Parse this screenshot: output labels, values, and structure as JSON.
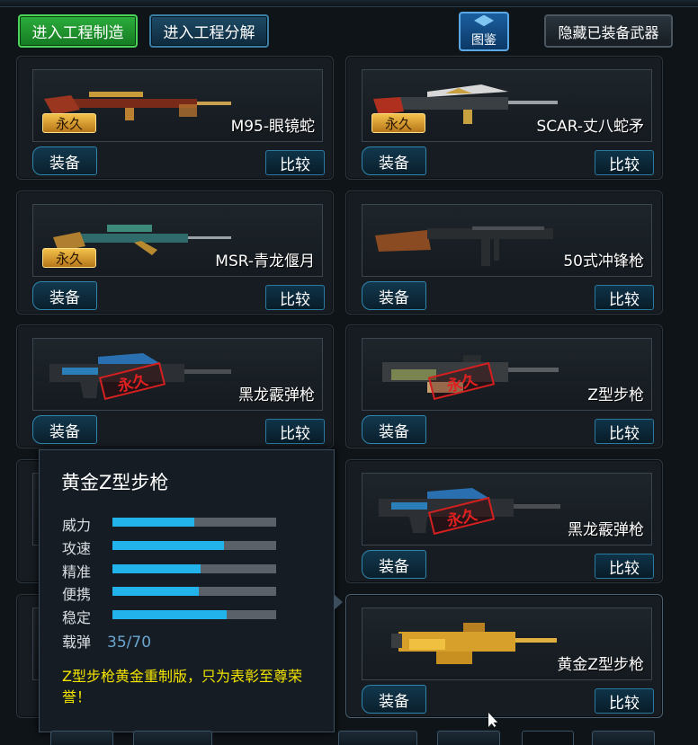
{
  "toolbar": {
    "enter_craft": "进入工程制造",
    "enter_disassemble": "进入工程分解",
    "gallery": "图鉴",
    "hide_equipped": "隐藏已装备武器"
  },
  "actions": {
    "equip": "装备",
    "compare": "比较"
  },
  "weapons": [
    {
      "name": "M95-眼镜蛇",
      "badge": "永久",
      "stamp": ""
    },
    {
      "name": "SCAR-丈八蛇矛",
      "badge": "永久",
      "stamp": ""
    },
    {
      "name": "MSR-青龙偃月",
      "badge": "永久",
      "stamp": ""
    },
    {
      "name": "50式冲锋枪",
      "badge": "",
      "stamp": ""
    },
    {
      "name": "黑龙霰弹枪",
      "badge": "",
      "stamp": "永久"
    },
    {
      "name": "Z型步枪",
      "badge": "",
      "stamp": "永久"
    },
    {
      "name": "",
      "badge": "",
      "stamp": ""
    },
    {
      "name": "黑龙霰弹枪",
      "badge": "",
      "stamp": "永久"
    },
    {
      "name": "",
      "badge": "",
      "stamp": ""
    },
    {
      "name": "黄金Z型步枪",
      "badge": "",
      "stamp": ""
    }
  ],
  "tooltip": {
    "title": "黄金Z型步枪",
    "stats": [
      {
        "label": "威力",
        "value": 0.5
      },
      {
        "label": "攻速",
        "value": 0.68
      },
      {
        "label": "精准",
        "value": 0.54
      },
      {
        "label": "便携",
        "value": 0.53
      },
      {
        "label": "稳定",
        "value": 0.7
      }
    ],
    "ammo_label": "载弹",
    "ammo_value": "35/70",
    "description": "Z型步枪黄金重制版，只为表彰至尊荣誉！"
  },
  "colors": {
    "stat_fill": "#22b3ea",
    "badge_gold": "#d79a2c",
    "stamp_red": "#d42020",
    "description_yellow": "#f2e300"
  }
}
